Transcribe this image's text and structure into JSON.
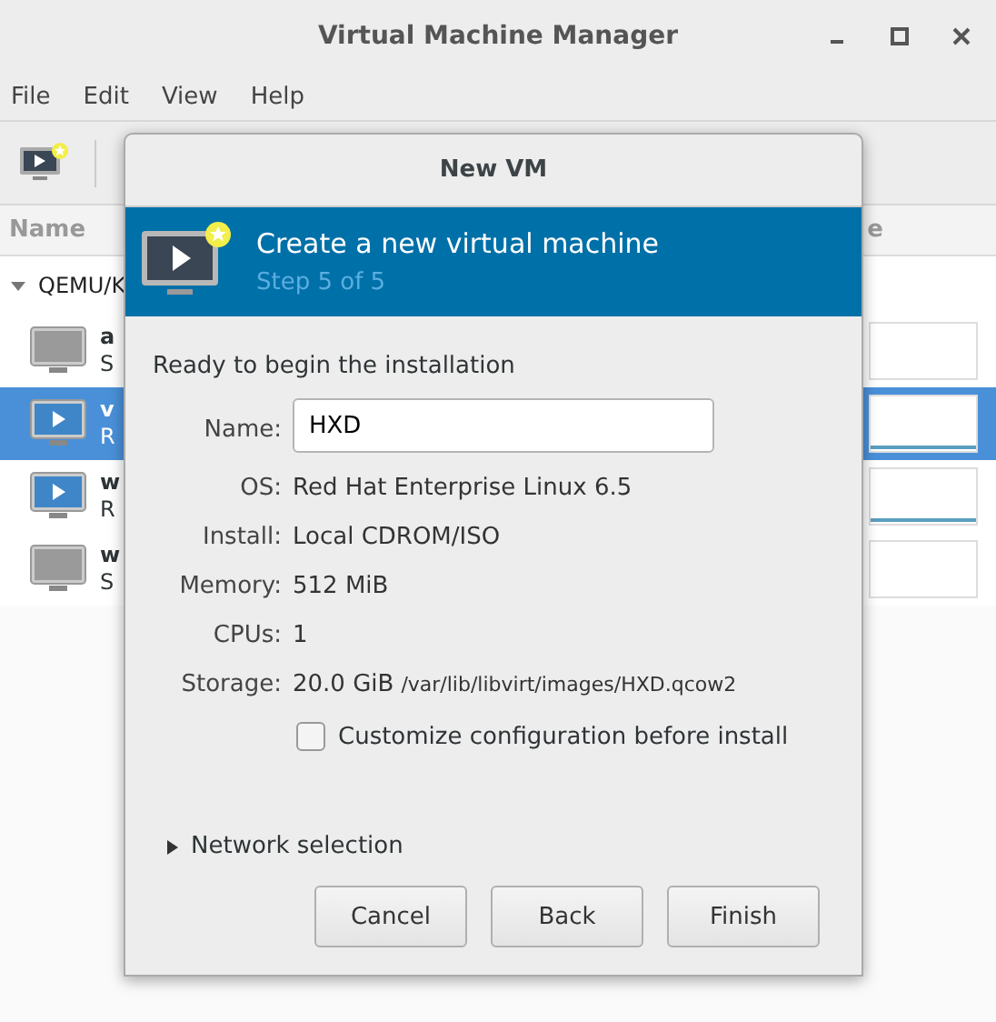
{
  "window": {
    "title": "Virtual Machine Manager"
  },
  "menu": [
    "File",
    "Edit",
    "View",
    "Help"
  ],
  "list": {
    "column_1": "Name",
    "column_2": "e"
  },
  "connection": {
    "label": "QEMU/K",
    "expanded": true
  },
  "vms": [
    {
      "name": "a",
      "status": "S",
      "kind": "shutoff",
      "selected": false
    },
    {
      "name": "v",
      "status": "R",
      "kind": "running",
      "selected": true
    },
    {
      "name": "w",
      "status": "R",
      "kind": "running",
      "selected": false
    },
    {
      "name": "w",
      "status": "S",
      "kind": "shutoff",
      "selected": false
    }
  ],
  "dialog": {
    "title": "New VM",
    "header": "Create a new virtual machine",
    "step": "Step 5 of 5",
    "intro": "Ready to begin the installation",
    "name_field": {
      "label": "Name:",
      "value": "HXD"
    },
    "details": [
      {
        "label": "OS:",
        "value": "Red Hat Enterprise Linux 6.5"
      },
      {
        "label": "Install:",
        "value": "Local CDROM/ISO"
      },
      {
        "label": "Memory:",
        "value": "512 MiB"
      },
      {
        "label": "CPUs:",
        "value": "1"
      },
      {
        "label": "Storage:",
        "value": "20.0 GiB",
        "path": "/var/lib/libvirt/images/HXD.qcow2"
      }
    ],
    "customize": {
      "label": "Customize configuration before install",
      "checked": false
    },
    "network": {
      "label": "Network selection",
      "expanded": false
    },
    "buttons": [
      "Cancel",
      "Back",
      "Finish"
    ]
  }
}
